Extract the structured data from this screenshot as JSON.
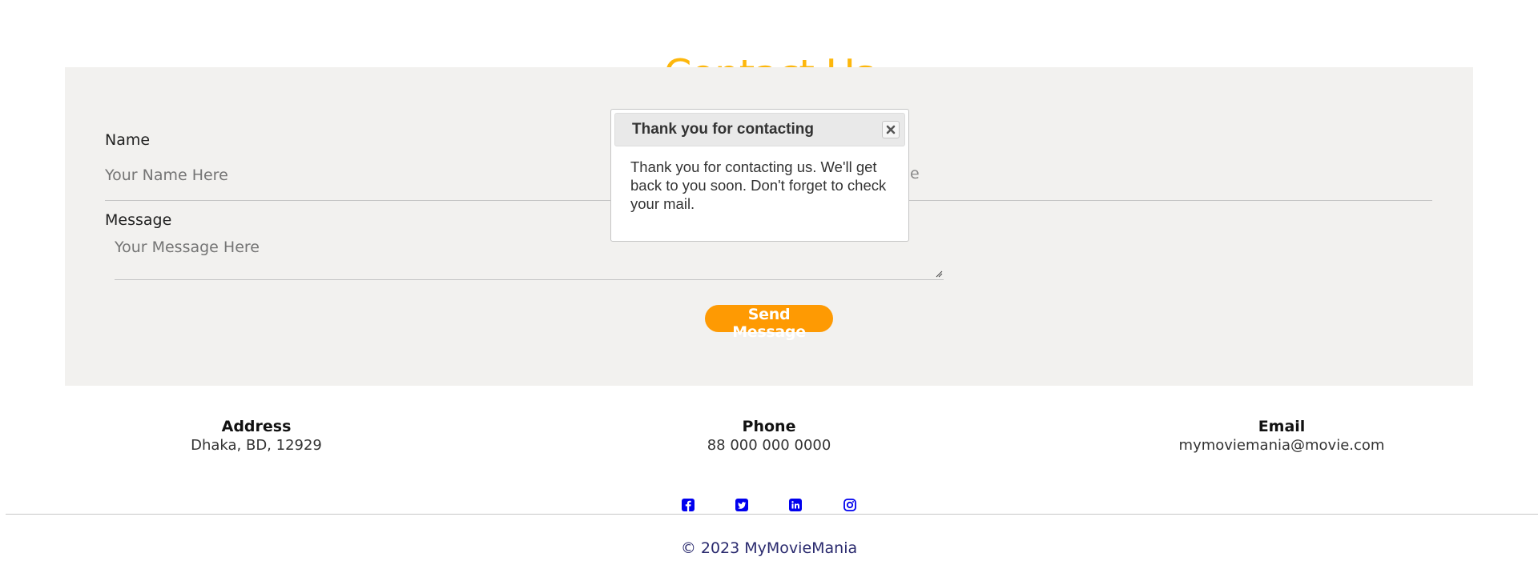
{
  "page": {
    "title": "Contact Us"
  },
  "form": {
    "name_label": "Name",
    "name_placeholder": "Your Name Here",
    "email_placeholder_fragment": "e",
    "message_label": "Message",
    "message_placeholder": "Your Message Here",
    "send_label": "Send Message"
  },
  "contact_info": {
    "address": {
      "title": "Address",
      "value": "Dhaka, BD, 12929"
    },
    "phone": {
      "title": "Phone",
      "value": "88 000 000 0000"
    },
    "email": {
      "title": "Email",
      "value": "mymoviemania@movie.com"
    }
  },
  "social": [
    {
      "icon": "facebook-icon"
    },
    {
      "icon": "twitter-icon"
    },
    {
      "icon": "linkedin-icon"
    },
    {
      "icon": "instagram-icon"
    }
  ],
  "footer": {
    "copyright": "© 2023 MyMovieMania"
  },
  "dialog": {
    "title": "Thank you for contacting",
    "body": "Thank you for contacting us. We'll get back to you soon. Don't forget to check your mail."
  },
  "colors": {
    "accent_title": "#fdb70c",
    "button": "#fe9a03",
    "panel_bg": "#f2f1ef",
    "social_icon": "#0000ee",
    "footer_text": "#2a2a6e"
  }
}
